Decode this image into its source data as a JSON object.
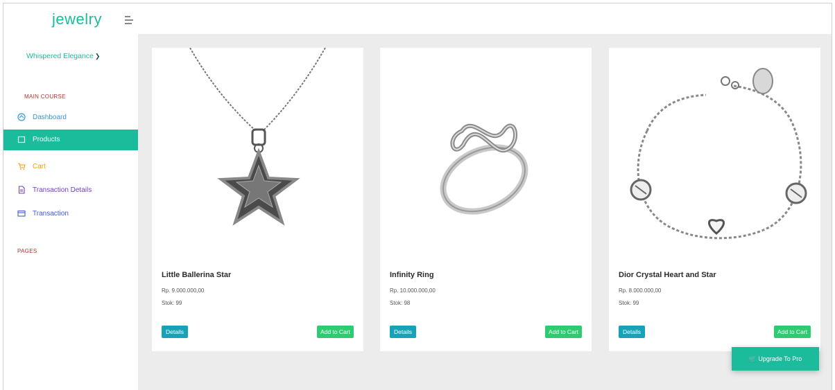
{
  "brand": {
    "name": "jewelry"
  },
  "sidebar": {
    "store_selector": "Whispered Elegance",
    "section_main": "MAIN COURSE",
    "items": [
      {
        "label": "Dashboard",
        "color": "#3498db"
      },
      {
        "label": "Products",
        "color": "#ffffff"
      },
      {
        "label": "Cart",
        "color": "#f39c12"
      },
      {
        "label": "Transaction Details",
        "color": "#6f42c1"
      },
      {
        "label": "Transaction",
        "color": "#3d5ad1"
      }
    ],
    "section_pages": "PAGES"
  },
  "products": [
    {
      "title": "Little Ballerina Star",
      "price": "Rp. 9.000.000,00",
      "stock": "Stok: 99",
      "details_label": "Details",
      "cart_label": "Add to Cart"
    },
    {
      "title": "Infinity Ring",
      "price": "Rp. 10.000.000,00",
      "stock": "Stok: 98",
      "details_label": "Details",
      "cart_label": "Add to Cart"
    },
    {
      "title": "Dior Crystal Heart and Star",
      "price": "Rp. 8.000.000,00",
      "stock": "Stok: 99",
      "details_label": "Details",
      "cart_label": "Add to Cart"
    }
  ],
  "upgrade": {
    "label": "Upgrade To Pro"
  },
  "colors": {
    "accent": "#1abc9c",
    "details": "#17a2b8",
    "cart": "#2ecc71",
    "section": "#b7322c"
  }
}
